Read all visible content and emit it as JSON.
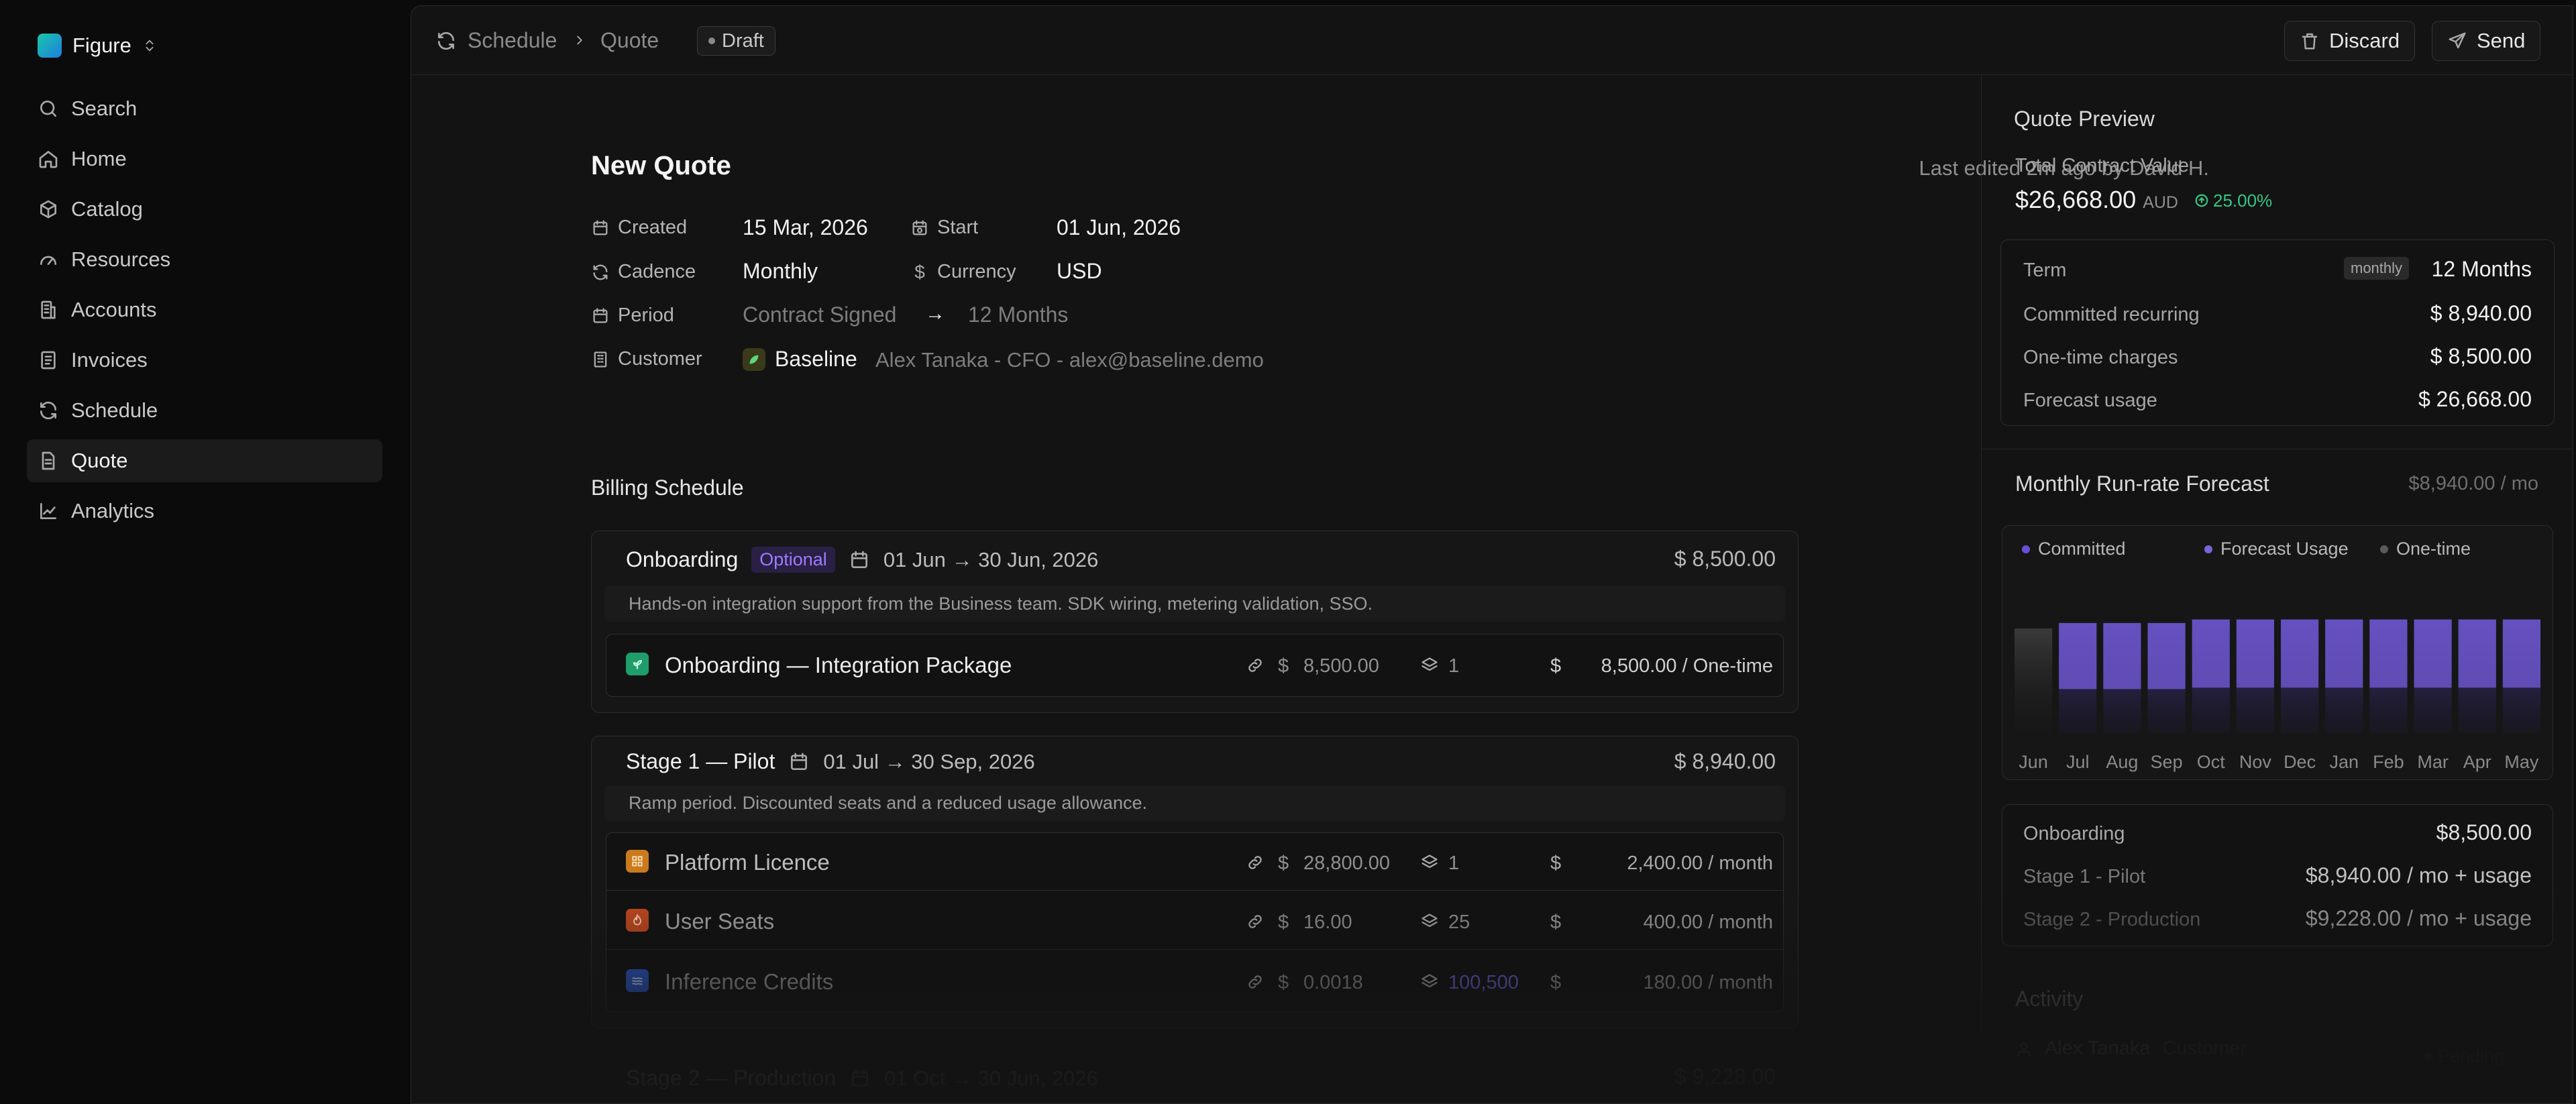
{
  "app": {
    "name": "Figure"
  },
  "nav": {
    "items": [
      {
        "label": "Search",
        "icon": "search-icon"
      },
      {
        "label": "Home",
        "icon": "home-icon"
      },
      {
        "label": "Catalog",
        "icon": "box-icon"
      },
      {
        "label": "Resources",
        "icon": "gauge-icon"
      },
      {
        "label": "Accounts",
        "icon": "building-icon"
      },
      {
        "label": "Invoices",
        "icon": "invoice-icon"
      },
      {
        "label": "Schedule",
        "icon": "refresh-icon"
      },
      {
        "label": "Quote",
        "icon": "document-icon",
        "active": true
      },
      {
        "label": "Analytics",
        "icon": "chart-icon"
      }
    ]
  },
  "topbar": {
    "breadcrumb": [
      "Schedule",
      "Quote"
    ],
    "status": "Draft",
    "discard_label": "Discard",
    "send_label": "Send"
  },
  "quote": {
    "title": "New Quote",
    "last_edited": "Last edited 2m ago by David H.",
    "created_label": "Created",
    "created_value": "15 Mar, 2026",
    "start_label": "Start",
    "start_value": "01 Jun, 2026",
    "cadence_label": "Cadence",
    "cadence_value": "Monthly",
    "currency_label": "Currency",
    "currency_value": "USD",
    "period_label": "Period",
    "period_from": "Contract Signed",
    "period_arrow": "→",
    "period_to": "12 Months",
    "customer_label": "Customer",
    "customer_name": "Baseline",
    "customer_contact": "Alex Tanaka - CFO - alex@baseline.demo"
  },
  "billing": {
    "title": "Billing Schedule",
    "stages": [
      {
        "name": "Onboarding",
        "badge": "Optional",
        "dates": "01 Jun → 30 Jun, 2026",
        "amount": "$ 8,500.00",
        "description": "Hands-on integration support from the Business team. SDK wiring, metering validation, SSO.",
        "items": [
          {
            "name": "Onboarding — Integration Package",
            "price": "8,500.00",
            "qty": "1",
            "total": "8,500.00 / One-time",
            "color": "#1f9d6b"
          }
        ]
      },
      {
        "name": "Stage 1 — Pilot",
        "dates": "01 Jul → 30 Sep, 2026",
        "amount": "$ 8,940.00",
        "description": "Ramp period. Discounted seats and a reduced usage allowance.",
        "items": [
          {
            "name": "Platform Licence",
            "price": "28,800.00",
            "qty": "1",
            "total": "2,400.00 / month",
            "color": "#c97a1e"
          },
          {
            "name": "User Seats",
            "price": "16.00",
            "qty": "25",
            "total": "400.00 / month",
            "color": "#c2491e"
          },
          {
            "name": "Inference Credits",
            "price": "0.0018",
            "qty": "100,500",
            "total": "180.00 / month",
            "color": "#2a57c9"
          }
        ]
      },
      {
        "name": "Stage 2 — Production",
        "dates": "01 Oct → 30 Jun, 2026",
        "amount": "$ 9,228.00"
      }
    ],
    "currency_symbol": "$"
  },
  "preview": {
    "title": "Quote Preview",
    "tcv_label": "Total Contract Value",
    "tcv_value": "$26,668.00",
    "tcv_currency": "AUD",
    "tcv_change": "25.00%",
    "term_label": "Term",
    "term_tag": "monthly",
    "term_value": "12 Months",
    "committed_label": "Committed recurring",
    "committed_value": "$ 8,940.00",
    "onetime_label": "One-time charges",
    "onetime_value": "$ 8,500.00",
    "forecast_label": "Forecast usage",
    "forecast_value": "$ 26,668.00",
    "runrate_title": "Monthly Run-rate Forecast",
    "runrate_value": "$8,940.00 / mo",
    "breakdown": [
      {
        "label": "Onboarding",
        "value": "$8,500.00"
      },
      {
        "label": "Stage 1 - Pilot",
        "value": "$8,940.00 / mo + usage"
      },
      {
        "label": "Stage 2 - Production",
        "value": "$9,228.00 / mo + usage"
      }
    ],
    "activity_title": "Activity",
    "activity_name": "Alex Tanaka",
    "activity_role": "Customer",
    "activity_status": "Pending"
  },
  "chart_data": {
    "type": "bar",
    "categories": [
      "Jun",
      "Jul",
      "Aug",
      "Sep",
      "Oct",
      "Nov",
      "Dec",
      "Jan",
      "Feb",
      "Mar",
      "Apr",
      "May"
    ],
    "series": [
      {
        "name": "Committed",
        "values": [
          0,
          8940,
          8940,
          8940,
          9228,
          9228,
          9228,
          9228,
          9228,
          9228,
          9228,
          9228
        ]
      },
      {
        "name": "Forecast Usage",
        "values": [
          0,
          720,
          720,
          720,
          840,
          960,
          1080,
          1200,
          1320,
          1440,
          1560,
          1320
        ]
      },
      {
        "name": "One-time",
        "values": [
          8500,
          0,
          0,
          0,
          0,
          0,
          0,
          0,
          0,
          0,
          0,
          0
        ]
      }
    ],
    "colors": {
      "Committed": "#6a4fd6",
      "Forecast Usage": "#7b64d9",
      "One-time": "#5a5a5a"
    },
    "legend": "top-left",
    "grid": false
  }
}
